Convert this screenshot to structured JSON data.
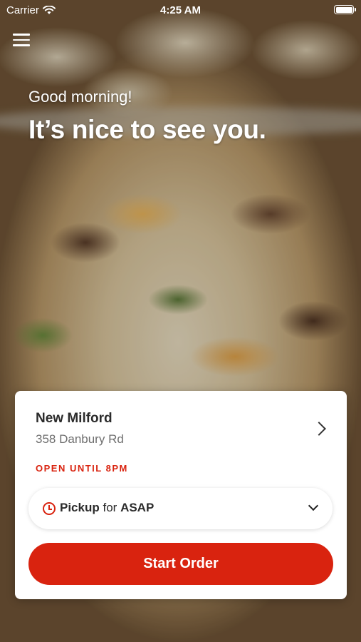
{
  "status_bar": {
    "carrier": "Carrier",
    "time": "4:25 AM"
  },
  "greeting": {
    "small": "Good morning!",
    "big": "It’s nice to see you."
  },
  "location": {
    "name": "New Milford",
    "address": "358 Danbury Rd",
    "hours": "OPEN UNTIL 8PM"
  },
  "order_mode": {
    "method": "Pickup",
    "connector": "for",
    "time": "ASAP"
  },
  "start_order_label": "Start Order",
  "colors": {
    "accent": "#d9230f",
    "text": "#2b2b2b",
    "muted": "#6e6e6e"
  }
}
